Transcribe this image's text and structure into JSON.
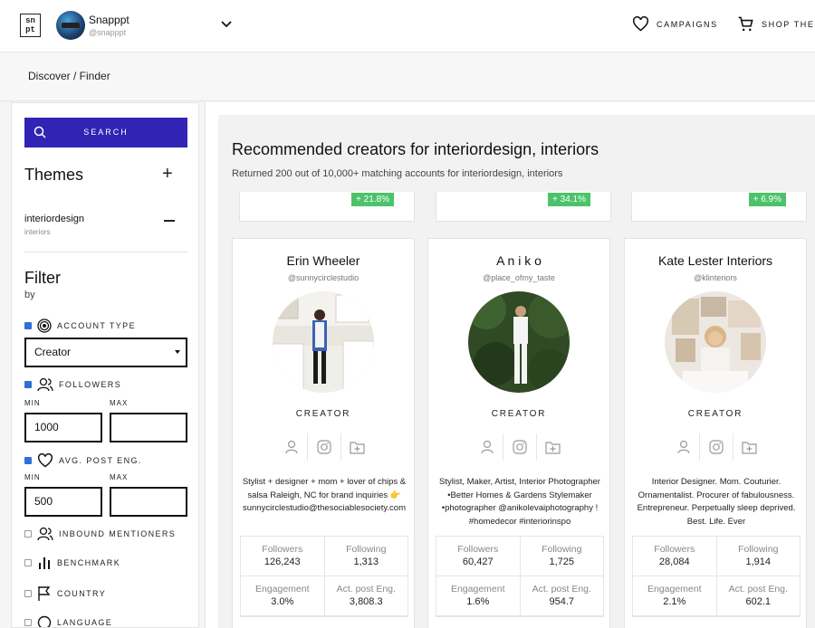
{
  "header": {
    "logo": "sn\npt",
    "account_name": "Snapppt",
    "account_handle": "@snapppt",
    "campaigns_label": "CAMPAIGNS",
    "shop_label": "SHOP THE FE"
  },
  "breadcrumb": "Discover / Finder",
  "sidebar": {
    "search_label": "SEARCH",
    "themes_title": "Themes",
    "theme": {
      "name": "interiordesign",
      "sub": "interiors"
    },
    "filter_title": "Filter",
    "filter_by": "by",
    "account_type_label": "ACCOUNT TYPE",
    "account_type_value": "Creator",
    "followers_label": "FOLLOWERS",
    "min_label": "MIN",
    "max_label": "MAX",
    "followers_min": "1000",
    "avg_post_label": "AVG. POST ENG.",
    "avg_min": "500",
    "inbound_label": "INBOUND MENTIONERS",
    "benchmark_label": "BENCHMARK",
    "country_label": "COUNTRY",
    "language_label": "LANGUAGE"
  },
  "main": {
    "title": "Recommended creators for interiordesign, interiors",
    "subtitle": "Returned 200 out of 10,000+ matching accounts for interiordesign, interiors",
    "prev_pills": [
      "+ 21.8%",
      "+ 34.1%",
      "+ 6.9%"
    ],
    "cards": [
      {
        "name": "Erin Wheeler",
        "handle": "@sunnycirclestudio",
        "type": "CREATOR",
        "bio": "Stylist + designer + mom + lover of chips & salsa Raleigh, NC for brand inquiries 👉 sunnycirclestudio@thesociablesociety.com",
        "followers": "126,243",
        "following": "1,313",
        "engagement": "3.0%",
        "act_post_eng": "3,808.3"
      },
      {
        "name": "A n i k o",
        "handle": "@place_ofmy_taste",
        "type": "CREATOR",
        "bio": "Stylist, Maker, Artist, Interior Photographer •Better Homes & Gardens Stylemaker •photographer @anikolevaiphotography ! #homedecor #interiorinspo",
        "followers": "60,427",
        "following": "1,725",
        "engagement": "1.6%",
        "act_post_eng": "954.7"
      },
      {
        "name": "Kate Lester Interiors",
        "handle": "@klinteriors",
        "type": "CREATOR",
        "bio": "Interior Designer. Mom. Couturier. Ornamentalist. Procurer of fabulousness. Entrepreneur. Perpetually sleep deprived. Best. Life. Ever",
        "followers": "28,084",
        "following": "1,914",
        "engagement": "2.1%",
        "act_post_eng": "602.1"
      }
    ],
    "stat_labels": {
      "followers": "Followers",
      "following": "Following",
      "engagement": "Engagement",
      "act_post_eng": "Act. post Eng."
    }
  },
  "colors": {
    "accent": "#3124b5",
    "growth": "#4cc36a",
    "checkbox": "#2f6fd6"
  }
}
